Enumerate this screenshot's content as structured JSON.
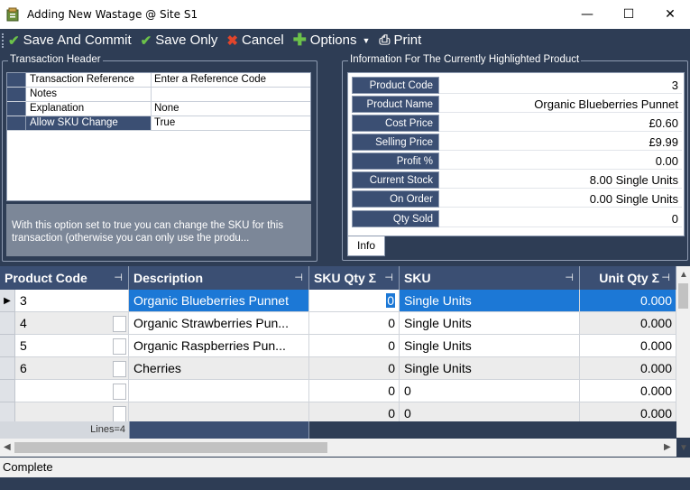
{
  "window": {
    "title": "Adding New Wastage @ Site S1",
    "minimize": "—",
    "maximize": "☐",
    "close": "✕"
  },
  "toolbar": {
    "save_commit": "Save And Commit",
    "save_only": "Save Only",
    "cancel": "Cancel",
    "options": "Options",
    "print": "Print"
  },
  "transaction_header": {
    "title": "Transaction Header",
    "rows": [
      {
        "name": "Transaction Reference",
        "value": "Enter a Reference Code"
      },
      {
        "name": "Notes",
        "value": ""
      },
      {
        "name": "Explanation",
        "value": "None"
      },
      {
        "name": "Allow SKU Change",
        "value": "True"
      }
    ],
    "help_text": "With this option set to true you can change the SKU for this transaction (otherwise you can only use the produ..."
  },
  "product_info": {
    "title": "Information For The Currently Highlighted Product",
    "tab": "Info",
    "rows": [
      {
        "label": "Product Code",
        "value": "3"
      },
      {
        "label": "Product Name",
        "value": "Organic Blueberries Punnet"
      },
      {
        "label": "Cost Price",
        "value": "£0.60"
      },
      {
        "label": "Selling Price",
        "value": "£9.99"
      },
      {
        "label": "Profit %",
        "value": "0.00"
      },
      {
        "label": "Current Stock",
        "value": "8.00 Single Units"
      },
      {
        "label": "On Order",
        "value": "0.00 Single Units"
      },
      {
        "label": "Qty Sold",
        "value": "0"
      }
    ]
  },
  "grid": {
    "headers": {
      "product_code": "Product Code",
      "description": "Description",
      "sku_qty": "SKU Qty Σ",
      "sku": "SKU",
      "unit_qty": "Unit Qty Σ"
    },
    "rows": [
      {
        "code": "3",
        "desc": "Organic Blueberries Punnet",
        "sku_qty": "0",
        "sku": "Single Units",
        "unit_qty": "0.000"
      },
      {
        "code": "4",
        "desc": "Organic Strawberries Pun...",
        "sku_qty": "0",
        "sku": "Single Units",
        "unit_qty": "0.000"
      },
      {
        "code": "5",
        "desc": "Organic Raspberries Pun...",
        "sku_qty": "0",
        "sku": "Single Units",
        "unit_qty": "0.000"
      },
      {
        "code": "6",
        "desc": "Cherries",
        "sku_qty": "0",
        "sku": "Single Units",
        "unit_qty": "0.000"
      },
      {
        "code": "",
        "desc": "",
        "sku_qty": "0",
        "sku": "0",
        "unit_qty": "0.000"
      },
      {
        "code": "",
        "desc": "",
        "sku_qty": "0",
        "sku": "0",
        "unit_qty": "0.000"
      }
    ],
    "lines_label": "Lines=4"
  },
  "status": {
    "text": "Complete"
  }
}
